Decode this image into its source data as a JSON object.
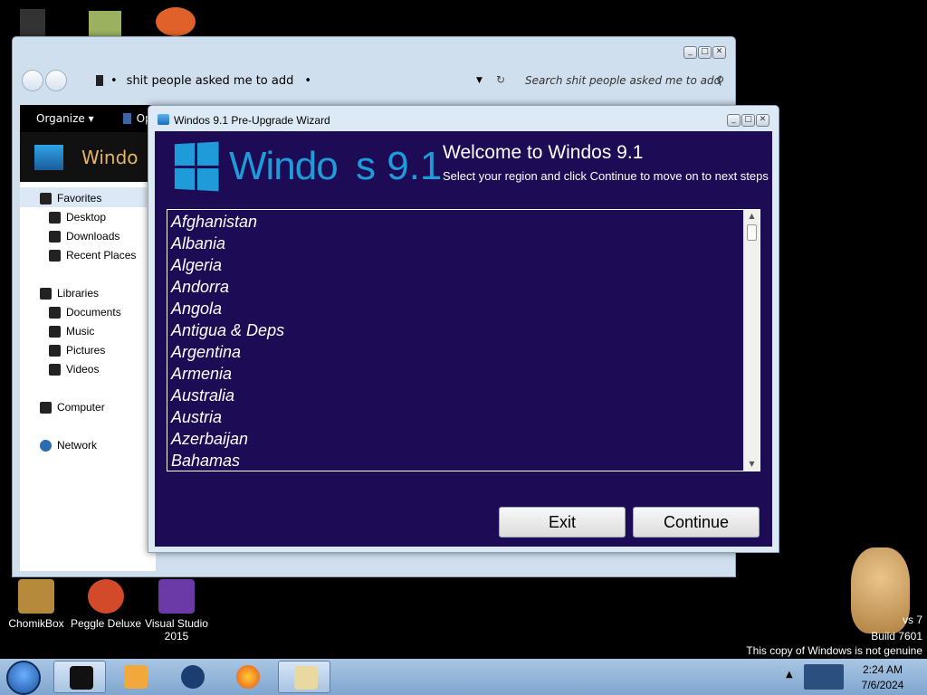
{
  "desktop": {
    "icons": [
      {
        "label": "ChomikBox"
      },
      {
        "label": "Peggle Deluxe"
      },
      {
        "label": "Visual Studio 2015"
      }
    ],
    "watermark": {
      "line1": "vs 7",
      "line2": "Build 7601",
      "line3": "This copy of Windows is not genuine"
    }
  },
  "explorer": {
    "address": "shit people asked me to add",
    "search_placeholder": "Search shit people asked me to add",
    "toolbar": {
      "organize": "Organize ▾",
      "second": "Op"
    },
    "banner_text": "Windo",
    "nav": {
      "favorites": "Favorites",
      "desktop": "Desktop",
      "downloads": "Downloads",
      "recent_places": "Recent Places",
      "libraries": "Libraries",
      "documents": "Documents",
      "music": "Music",
      "pictures": "Pictures",
      "videos": "Videos",
      "computer": "Computer",
      "network": "Network"
    }
  },
  "wizard": {
    "title": "Windos 9.1 Pre-Upgrade Wizard",
    "logo_text": "Windo",
    "logo_version": "s 9.1",
    "welcome": "Welcome to Windos 9.1",
    "subtitle": "Select your region and click Continue to move on to next steps",
    "countries": [
      "Afghanistan",
      "Albania",
      "Algeria",
      "Andorra",
      "Angola",
      "Antigua & Deps",
      "Argentina",
      "Armenia",
      "Australia",
      "Austria",
      "Azerbaijan",
      "Bahamas"
    ],
    "exit_label": "Exit",
    "continue_label": "Continue"
  },
  "taskbar": {
    "time": "2:24 AM",
    "date": "7/6/2024"
  },
  "colors": {
    "wizard_bg": "#1d0c55",
    "logo_blue": "#1e9bd8"
  }
}
